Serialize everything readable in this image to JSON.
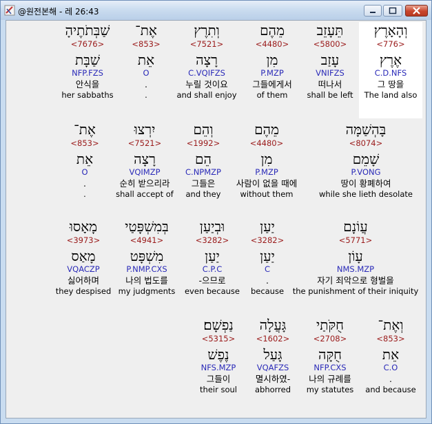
{
  "window": {
    "title": "@원전본해 - 레 26:43",
    "minimize_label": "‒",
    "maximize_label": "□",
    "close_label": "✕"
  },
  "words": [
    {
      "heb": "וְהָאָרֶץ",
      "num": "<776>",
      "lemma": "אֶרֶץ",
      "code": "C.D.NFS",
      "ko": "그 땅을",
      "en": "The land also",
      "highlighted": true
    },
    {
      "heb": "תֵּעָזֵב",
      "num": "<5800>",
      "lemma": "עָזַב",
      "code": "VNIFZS",
      "ko": "떠나서",
      "en": "shall be left"
    },
    {
      "heb": "מֵהֶם",
      "num": "<4480>",
      "lemma": "מִן",
      "code": "P.MZP",
      "ko": "그들에게서",
      "en": "of them"
    },
    {
      "heb": "וְתִרֶץ",
      "num": "<7521>",
      "lemma": "רָצָה",
      "code": "C.VQIFZS",
      "ko": "누릴 것이요",
      "en": "and shall enjoy"
    },
    {
      "heb": "אֶת־",
      "num": "<853>",
      "lemma": "אֵת",
      "code": "O",
      "ko": ".",
      "en": "."
    },
    {
      "heb": "שַׁבְּתֹתֶיהָ",
      "num": "<7676>",
      "lemma": "שַׁבָּת",
      "code": "NFP.FZS",
      "ko": "안식을",
      "en": "her sabbaths"
    },
    {
      "heb": "בָּהְשַׁמָּה",
      "num": "<8074>",
      "lemma": "שָׁמֵם",
      "code": "P.VONG",
      "ko": "땅이 황폐하여",
      "en": "while she lieth desolate"
    },
    {
      "heb": "מֵהֶם",
      "num": "<4480>",
      "lemma": "מִן",
      "code": "P.MZP",
      "ko": "사람이 없을 때에",
      "en": "without them"
    },
    {
      "heb": "וְהֵם",
      "num": "<1992>",
      "lemma": "הֵם",
      "code": "C.NPMZP",
      "ko": "그들은",
      "en": "and they"
    },
    {
      "heb": "יִרְצוּ",
      "num": "<7521>",
      "lemma": "רָצָה",
      "code": "VQIMZP",
      "ko": "순히 받으리라",
      "en": "shall accept of"
    },
    {
      "heb": "אֶת־",
      "num": "<853>",
      "lemma": "אֵת",
      "code": "O",
      "ko": ".",
      "en": "."
    },
    {
      "heb": "עֲוֹנָם",
      "num": "<5771>",
      "lemma": "עָוֹן",
      "code": "NMS.MZP",
      "ko": "자기 죄악으로 형벌을",
      "en": "the punishment of their iniquity"
    },
    {
      "heb": "יַעַן",
      "num": "<3282>",
      "lemma": "יַעַן",
      "code": "C",
      "ko": ".",
      "en": "because"
    },
    {
      "heb": "וּבְיַעַן",
      "num": "<3282>",
      "lemma": "יַעַן",
      "code": "C.P.C",
      "ko": "-으므로",
      "en": "even because"
    },
    {
      "heb": "בְּמִשְׁפָּטַי",
      "num": "<4941>",
      "lemma": "מִשְׁפָּט",
      "code": "P.NMP.CXS",
      "ko": "나의 법도를",
      "en": "my judgments"
    },
    {
      "heb": "מָאָסוּ",
      "num": "<3973>",
      "lemma": "מָאַס",
      "code": "VQACZP",
      "ko": "싫어하며",
      "en": "they despised"
    },
    {
      "heb": "וְאֶת־",
      "num": "<853>",
      "lemma": "אֵת",
      "code": "C.O",
      "ko": ".",
      "en": "and because"
    },
    {
      "heb": "חֻקֹּתַי",
      "num": "<2708>",
      "lemma": "חֻקָּה",
      "code": "NFP.CXS",
      "ko": "나의 규례를",
      "en": "my statutes"
    },
    {
      "heb": "גָּעֲלָה",
      "num": "<1602>",
      "lemma": "גָּעַל",
      "code": "VQAFZS",
      "ko": "멸시하였-",
      "en": "abhorred"
    },
    {
      "heb": "נַפְשָׁם׃",
      "num": "<5315>",
      "lemma": "נֶפֶשׁ",
      "code": "NFS.MZP",
      "ko": "그들이",
      "en": "their soul"
    }
  ]
}
